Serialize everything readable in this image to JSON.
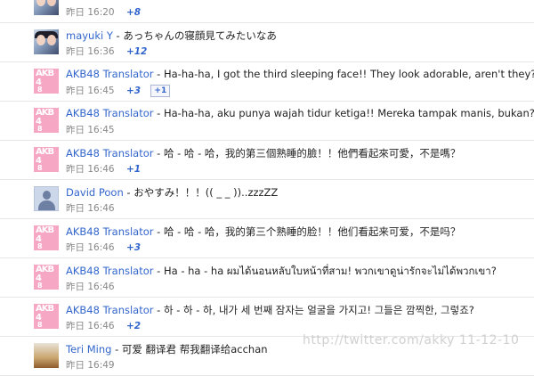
{
  "rows": [
    {
      "name": "",
      "text": "",
      "meta": "昨日 16:20",
      "plus": "+8",
      "avatar": "photo"
    },
    {
      "name": "mayuki Y",
      "text": "あっちゃんの寝顔見てみたいなあ",
      "meta": "昨日 16:36",
      "plus": "+12",
      "avatar": "photo"
    },
    {
      "name": "AKB48 Translator",
      "text": "Ha-ha-ha, I got the third sleeping face!! They look adorable, aren't they?",
      "meta": "昨日 16:45",
      "plus": "+3",
      "badge": "+1",
      "avatar": "akb"
    },
    {
      "name": "AKB48 Translator",
      "text": "Ha-ha-ha, aku punya wajah tidur ketiga!! Mereka tampak manis, bukan?",
      "meta": "昨日 16:45",
      "plus": "",
      "avatar": "akb"
    },
    {
      "name": "AKB48 Translator",
      "text": "哈 - 哈 - 哈，我的第三個熟睡的臉！！他們看起來可愛，不是嗎？",
      "meta": "昨日 16:46",
      "plus": "+1",
      "avatar": "akb"
    },
    {
      "name": "David Poon",
      "text": "おやすみ！！！(( _ _ ))..zzzZZ",
      "meta": "昨日 16:46",
      "plus": "",
      "avatar": "default"
    },
    {
      "name": "AKB48 Translator",
      "text": "哈 - 哈 - 哈，我的第三个熟睡的脸！！他们看起来可爱，不是吗？",
      "meta": "昨日 16:46",
      "plus": "+3",
      "avatar": "akb"
    },
    {
      "name": "AKB48 Translator",
      "text": "Ha - ha - ha ผมได้นอนหลับใบหน้าที่สาม! พวกเขาดูน่ารักจะไม่ได้พวกเขา?",
      "meta": "昨日 16:46",
      "plus": "",
      "avatar": "akb"
    },
    {
      "name": "AKB48 Translator",
      "text": "하 - 하 - 하, 내가 세 번째 잠자는 얼굴을 가지고! 그들은 깜찍한, 그렇죠?",
      "meta": "昨日 16:46",
      "plus": "+2",
      "avatar": "akb"
    },
    {
      "name": "Teri Ming",
      "text": "可爱 翻译君 帮我翻译给acchan",
      "meta": "昨日 16:49",
      "plus": "",
      "avatar": "scene"
    }
  ],
  "watermark": "http://twitter.com/akky 11-12-10",
  "colors": {
    "link": "#3366cc",
    "akb_avatar": "#f5a7c3",
    "meta": "#888888"
  }
}
